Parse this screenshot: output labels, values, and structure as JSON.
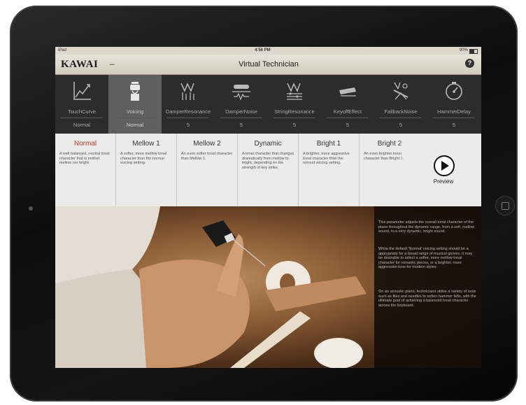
{
  "status": {
    "device": "iPad",
    "time": "4:56 PM",
    "battery": "90%"
  },
  "nav": {
    "logo": "KAWAI",
    "dash": "–",
    "title": "Virtual Technician",
    "help": "?"
  },
  "tools": [
    {
      "name": "TouchCurve",
      "value": "Normal",
      "icon": "touch-curve-icon"
    },
    {
      "name": "Voicing",
      "value": "Normal",
      "icon": "voicing-hammer-icon"
    },
    {
      "name": "DamperResonance",
      "value": "5",
      "icon": "damper-resonance-icon"
    },
    {
      "name": "DamperNoise",
      "value": "5",
      "icon": "damper-noise-icon"
    },
    {
      "name": "StringResonance",
      "value": "5",
      "icon": "string-resonance-icon"
    },
    {
      "name": "KeyoffEffect",
      "value": "5",
      "icon": "keyoff-effect-icon"
    },
    {
      "name": "FallbackNoise",
      "value": "5",
      "icon": "fallback-noise-icon"
    },
    {
      "name": "HammerDelay",
      "value": "5",
      "icon": "hammer-delay-icon"
    }
  ],
  "voicing": [
    {
      "title": "Normal",
      "desc": "A well balanced, neutral tonal character that is neither mellow nor bright."
    },
    {
      "title": "Mellow 1",
      "desc": "A softer, more mellow tonal character than the normal voicing setting."
    },
    {
      "title": "Mellow 2",
      "desc": "An even softer tonal character than Mellow 1."
    },
    {
      "title": "Dynamic",
      "desc": "A tonal character that changes dramatically from mellow to bright, depending on the strength of key strike."
    },
    {
      "title": "Bright 1",
      "desc": "A brighter, more aggressive tonal character than the normal voicing setting."
    },
    {
      "title": "Bright 2",
      "desc": "An even brighter tonal character than Bright 1."
    }
  ],
  "preview": {
    "label": "Preview"
  },
  "description": [
    "This parameter adjusts the overall tonal character of the piano throughout the dynamic range, from a soft, mellow sound, to a very dynamic, bright sound.",
    "While the default 'Normal' voicing setting should be a appropriate for a broad range of musical genres, it may be desirable to select a softer, more mellow tonal character for romantic pieces, or a brighter, more aggressive tone for modern styles.",
    "On an acoustic piano, technicians utilise a variety of tools such as files and needles to soften hammer felts, with the ultimate goal of achieving a balanced tonal character across the keyboard."
  ],
  "colors": {
    "selected_text": "#c0392b",
    "toolbar": "#2c2c2c",
    "selected_tool": "#5f5f5f"
  }
}
